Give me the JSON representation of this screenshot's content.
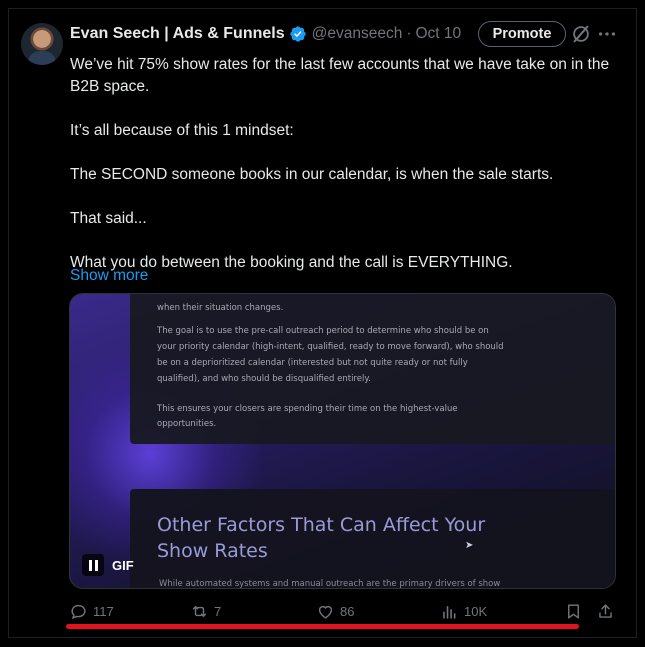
{
  "author": {
    "name": "Evan Seech | Ads & Funnels",
    "handle": "@evanseech",
    "separator": "·",
    "date": "Oct 10"
  },
  "header_actions": {
    "promote_label": "Promote",
    "grok_icon": "grok-slash-icon",
    "more_icon": "more-horizontal-icon"
  },
  "tweet": {
    "paragraphs": [
      "We’ve hit 75% show rates for the last few accounts that we have take on in the B2B space.",
      "It’s all because of this 1 mindset:",
      "The SECOND someone books in our calendar, is when the sale starts.",
      "That said...",
      "What you do between the booking and the call is EVERYTHING."
    ],
    "show_more": "Show more"
  },
  "media": {
    "type": "gif",
    "gif_label": "GIF",
    "lines": [
      "when their situation changes.",
      "The goal is to use the pre-call outreach period to determine who should be on",
      "your priority calendar (high-intent, qualified, ready to move forward), who should",
      "be on a deprioritized calendar (interested but not quite ready or not fully",
      "qualified), and who should be disqualified entirely.",
      "This ensures your closers are spending their time on the highest-value",
      "opportunities."
    ],
    "heading_line1": "Other Factors That Can Affect Your",
    "heading_line2": "Show Rates",
    "footer_line": "While automated systems and manual outreach are the primary drivers of show"
  },
  "engagement": {
    "replies": "117",
    "reposts": "7",
    "likes": "86",
    "views": "10K"
  },
  "colors": {
    "background": "#000000",
    "text": "#e7e9ea",
    "muted": "#71767b",
    "link": "#1d9bf0",
    "verified": "#1d9bf0",
    "highlight": "#e3131d"
  }
}
